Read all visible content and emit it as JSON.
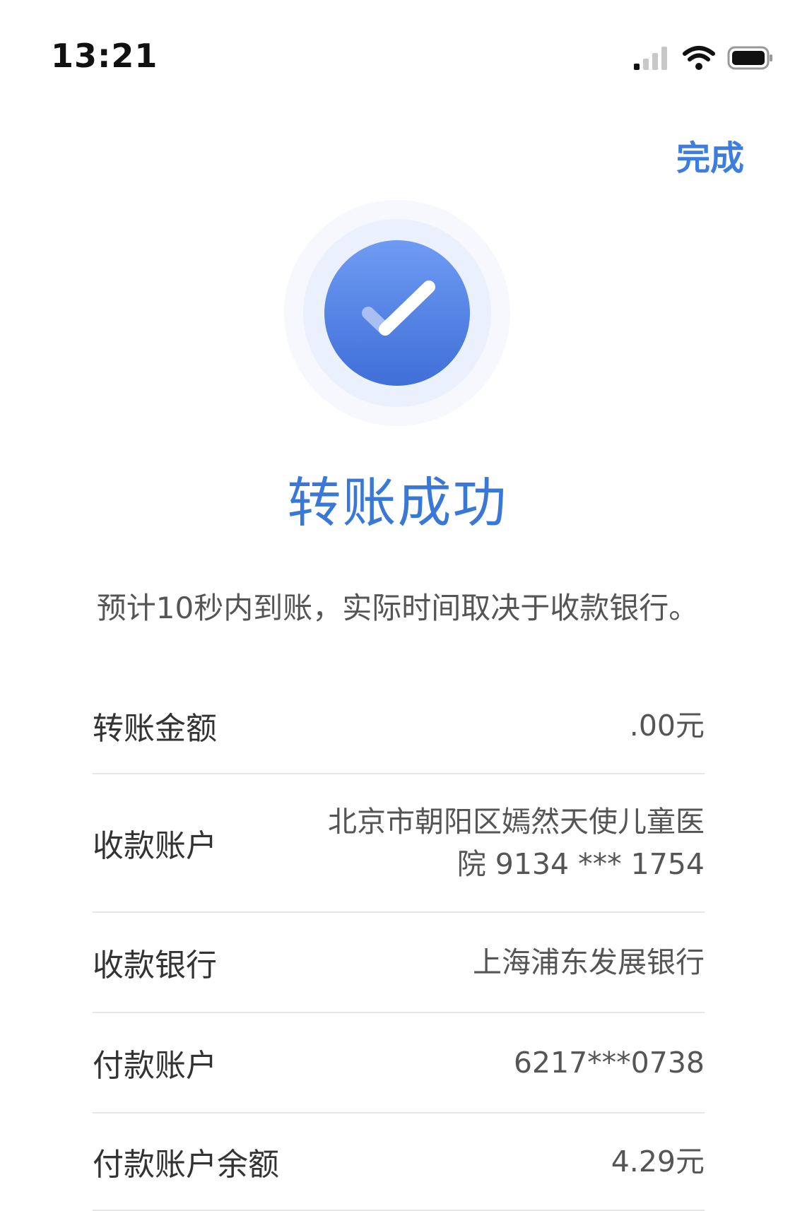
{
  "status_bar": {
    "time": "13:21"
  },
  "header": {
    "done_label": "完成"
  },
  "result": {
    "title": "转账成功",
    "subtitle": "预计10秒内到账，实际时间取决于收款银行。"
  },
  "details": [
    {
      "label": "转账金额",
      "value": ".00元"
    },
    {
      "label": "收款账户",
      "value": "北京市朝阳区嫣然天使儿童医院 9134 *** 1754"
    },
    {
      "label": "收款银行",
      "value": "上海浦东发展银行"
    },
    {
      "label": "付款账户",
      "value": "6217***0738"
    },
    {
      "label": "付款账户余额",
      "value": "4.29元"
    }
  ],
  "colors": {
    "accent": "#3b7de0",
    "check_circle_top": "#6f9bf3",
    "check_circle_bottom": "#3f6fd8",
    "halo": "#eef3fd"
  },
  "icons": {
    "signal": "signal-icon",
    "wifi": "wifi-icon",
    "battery": "battery-icon",
    "success": "checkmark-circle-icon"
  }
}
